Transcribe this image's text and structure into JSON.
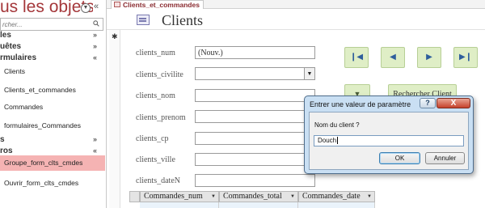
{
  "nav": {
    "title": "us les objets...",
    "search_placeholder": "rcher...",
    "groups": [
      {
        "label": "les",
        "chevron": "»"
      },
      {
        "label": "uêtes",
        "chevron": "»"
      },
      {
        "label": "rmulaires",
        "chevron": "«"
      },
      {
        "label": "s",
        "chevron": "»"
      },
      {
        "label": "ros",
        "chevron": "«"
      }
    ],
    "items": [
      {
        "label": "Clients"
      },
      {
        "label": "Clients_et_commandes"
      },
      {
        "label": "Commandes"
      },
      {
        "label": "formulaires_Commandes"
      },
      {
        "label": "Groupe_form_clts_cmdes"
      },
      {
        "label": "Ouvrir_form_clts_cmdes"
      }
    ]
  },
  "tab": {
    "label": "Clients_et_commandes"
  },
  "form": {
    "title": "Clients",
    "record_selector": "✱",
    "fields": [
      {
        "label": "clients_num",
        "value": "(Nouv.)"
      },
      {
        "label": "clients_civilite",
        "value": ""
      },
      {
        "label": "clients_nom",
        "value": ""
      },
      {
        "label": "clients_prenom",
        "value": ""
      },
      {
        "label": "clients_cp",
        "value": ""
      },
      {
        "label": "clients_ville",
        "value": ""
      },
      {
        "label": "clients_dateN",
        "value": ""
      }
    ],
    "search_button": "Rechercher Client"
  },
  "subform": {
    "columns": [
      "Commandes_num",
      "Commandes_total",
      "Commandes_date"
    ]
  },
  "dialog": {
    "title": "Entrer une valeur de paramètre",
    "help": "?",
    "close": "X",
    "prompt": "Nom du client ?",
    "value": "Douch",
    "ok": "OK",
    "cancel": "Annuler"
  },
  "colors": {
    "nav_title": "#a4373a",
    "selected_item": "#f5b3b3",
    "nav_button_bg": "#dfeec6",
    "dialog_frame": "#c9dff3"
  }
}
